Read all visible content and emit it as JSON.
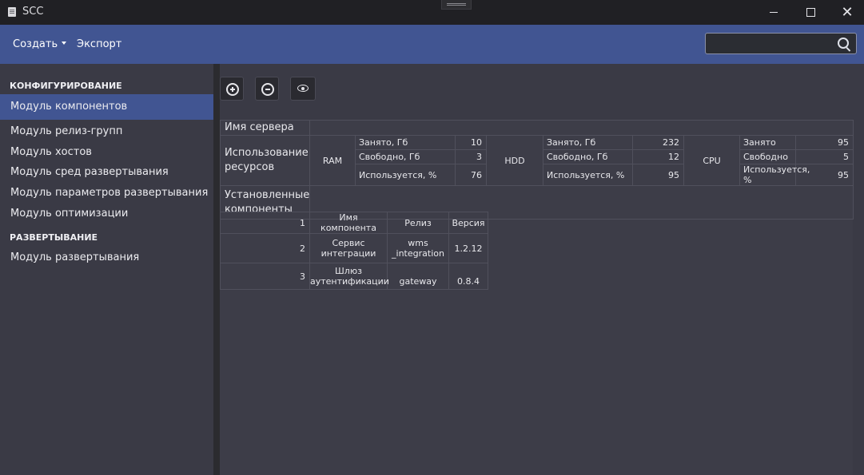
{
  "window": {
    "title": "SCC"
  },
  "menu": {
    "create": "Создать",
    "export": "Экспорт"
  },
  "search": {
    "placeholder": ""
  },
  "sidebar": {
    "section1": "КОНФИГУРИРОВАНИЕ",
    "items1": [
      "Модуль компонентов",
      "Модуль релиз-групп",
      "Модуль хостов",
      "Модуль сред развертывания",
      "Модуль параметров развертывания",
      "Модуль оптимизации"
    ],
    "section2": "РАЗВЕРТЫВАНИЕ",
    "items2": [
      "Модуль развертывания"
    ],
    "active_index": 0
  },
  "toolbar": {
    "add_icon": "plus-circle-icon",
    "remove_icon": "minus-circle-icon",
    "view_icon": "eye-icon"
  },
  "server": {
    "name_label": "Имя сервера",
    "name_value": "",
    "resources_label": "Использование ресурсов",
    "ram": {
      "label": "RAM",
      "rows": [
        {
          "k": "Занято, Гб",
          "v": "10"
        },
        {
          "k": "Свободно, Гб",
          "v": "3"
        },
        {
          "k": "Используется, %",
          "v": "76"
        }
      ]
    },
    "hdd": {
      "label": "HDD",
      "rows": [
        {
          "k": "Занято, Гб",
          "v": "232"
        },
        {
          "k": "Свободно, Гб",
          "v": "12"
        },
        {
          "k": "Используется, %",
          "v": "95"
        }
      ]
    },
    "cpu": {
      "label": "CPU",
      "rows": [
        {
          "k": "Занято",
          "v": "95"
        },
        {
          "k": "Свободно",
          "v": "5"
        },
        {
          "k": "Используется, %",
          "v": "95"
        }
      ]
    },
    "installed_label": "Установленные компоненты"
  },
  "components": {
    "headers": [
      "Имя компонента",
      "Релиз",
      "Версия"
    ],
    "rows": [
      {
        "n": "1",
        "name": "Имя компонента",
        "release": "Релиз",
        "version": "Версия"
      },
      {
        "n": "2",
        "name": "Сервис интеграции",
        "release": "wms _integration",
        "version": "1.2.12"
      },
      {
        "n": "3",
        "name": "Шлюз аутентификации",
        "release": "gateway",
        "version": "0.8.4"
      }
    ]
  },
  "colors": {
    "accent": "#415592",
    "background": "#3a3a45",
    "titlebar": "#202024"
  }
}
